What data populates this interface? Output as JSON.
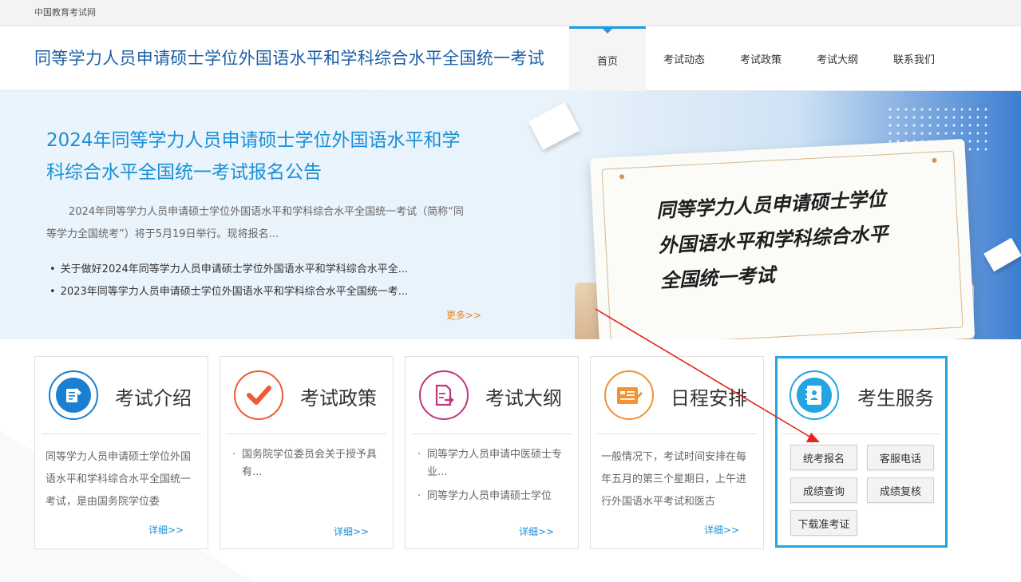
{
  "topbar": {
    "site_name": "中国教育考试网"
  },
  "header": {
    "title": "同等学力人员申请硕士学位外国语水平和学科综合水平全国统一考试",
    "nav": [
      "首页",
      "考试动态",
      "考试政策",
      "考试大纲",
      "联系我们"
    ],
    "active_nav": "首页"
  },
  "banner": {
    "headline": "2024年同等学力人员申请硕士学位外国语水平和学科综合水平全国统一考试报名公告",
    "summary": "2024年同等学力人员申请硕士学位外国语水平和学科综合水平全国统一考试（简称“同等学力全国统考”）将于5月19日举行。现将报名...",
    "links": [
      "关于做好2024年同等学力人员申请硕士学位外国语水平和学科综合水平全...",
      "2023年同等学力人员申请硕士学位外国语水平和学科综合水平全国统一考..."
    ],
    "more": "更多>>",
    "card_text": [
      "同等学力人员申请硕士学位",
      "外国语水平和学科综合水平",
      "全国统一考试"
    ]
  },
  "cards": {
    "intro": {
      "title": "考试介绍",
      "body": "同等学力人员申请硕士学位外国语水平和学科综合水平全国统一考试，是由国务院学位委",
      "more": "详细>>"
    },
    "policy": {
      "title": "考试政策",
      "items": [
        "国务院学位委员会关于授予具有..."
      ],
      "more": "详细>>"
    },
    "syllabus": {
      "title": "考试大纲",
      "items": [
        "同等学力人员申请中医硕士专业...",
        "同等学力人员申请硕士学位"
      ],
      "more": "详细>>"
    },
    "schedule": {
      "title": "日程安排",
      "body": "一般情况下，考试时间安排在每年五月的第三个星期日，上午进行外国语水平考试和医古",
      "more": "详细>>"
    },
    "service": {
      "title": "考生服务",
      "buttons": [
        "统考报名",
        "客服电话",
        "成绩查询",
        "成绩复核",
        "下载准考证"
      ]
    }
  },
  "colors": {
    "brand_blue": "#1b5fa8",
    "accent_blue": "#1a8fd6",
    "orange": "#e8841f",
    "annotation_red": "#e8221b"
  }
}
